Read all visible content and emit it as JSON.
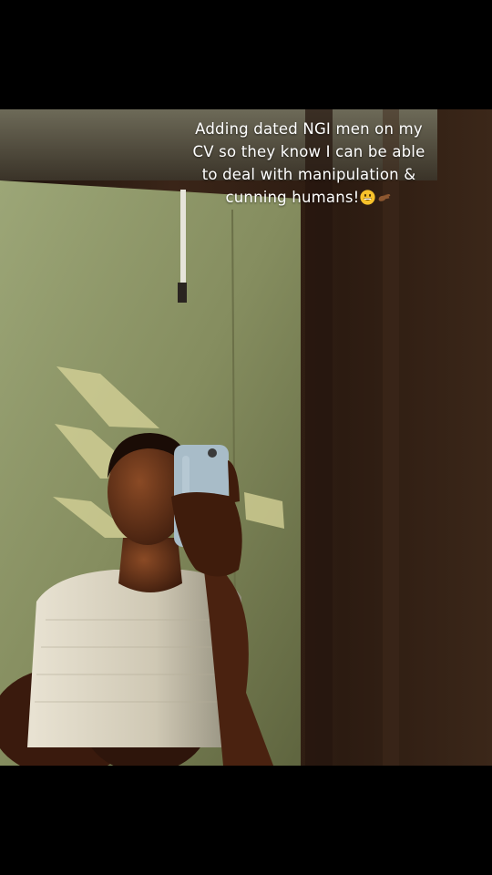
{
  "caption": {
    "text": "Adding dated NGI men on my CV so they know I can be able to deal with manipulation & cunning humans!",
    "emojis": [
      "grinning-face-emoji",
      "pinched-fingers-hand-emoji"
    ]
  },
  "colors": {
    "background": "#000000",
    "caption_text": "#ffffff",
    "wall": "#8e9766",
    "curtain": "#2a1a12"
  }
}
